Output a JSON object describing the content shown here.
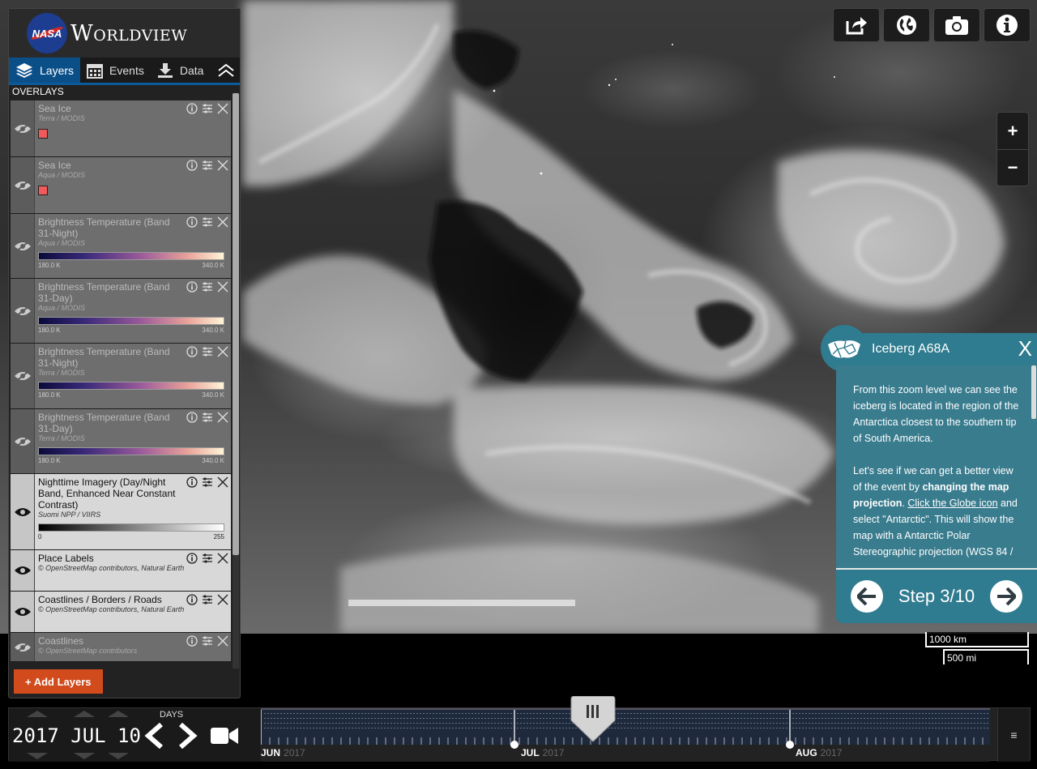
{
  "app": {
    "brand_text": "NASA",
    "title": "Worldview"
  },
  "tabs": [
    {
      "label": "Layers",
      "icon": "layers-icon"
    },
    {
      "label": "Events",
      "icon": "calendar-icon"
    },
    {
      "label": "Data",
      "icon": "download-icon"
    }
  ],
  "overlays_heading": "OVERLAYS",
  "layers": [
    {
      "name": "Sea Ice",
      "source": "Terra / MODIS",
      "visible": false,
      "legend": "swatch",
      "swatch_color": "#f05a5a"
    },
    {
      "name": "Sea Ice",
      "source": "Aqua / MODIS",
      "visible": false,
      "legend": "swatch",
      "swatch_color": "#f05a5a"
    },
    {
      "name": "Brightness Temperature (Band 31-Night)",
      "source": "Aqua / MODIS",
      "visible": false,
      "legend": "colorbar",
      "min": "180.0 K",
      "max": "340.0 K"
    },
    {
      "name": "Brightness Temperature (Band 31-Day)",
      "source": "Aqua / MODIS",
      "visible": false,
      "legend": "colorbar",
      "min": "180.0 K",
      "max": "340.0 K"
    },
    {
      "name": "Brightness Temperature (Band 31-Night)",
      "source": "Terra / MODIS",
      "visible": false,
      "legend": "colorbar",
      "min": "180.0 K",
      "max": "340.0 K"
    },
    {
      "name": "Brightness Temperature (Band 31-Day)",
      "source": "Terra / MODIS",
      "visible": false,
      "legend": "colorbar",
      "min": "180.0 K",
      "max": "340.0 K"
    },
    {
      "name": "Nighttime Imagery (Day/Night Band, Enhanced Near Constant Contrast)",
      "source": "Suomi NPP / VIIRS",
      "visible": true,
      "legend": "graybar",
      "min": "0",
      "max": "255"
    },
    {
      "name": "Place Labels",
      "source": "© OpenStreetMap contributors, Natural Earth",
      "visible": true,
      "legend": "none"
    },
    {
      "name": "Coastlines / Borders / Roads",
      "source": "© OpenStreetMap contributors, Natural Earth",
      "visible": true,
      "legend": "none"
    },
    {
      "name": "Coastlines",
      "source": "© OpenStreetMap contributors",
      "visible": false,
      "legend": "none"
    }
  ],
  "add_layers_label": "+ Add Layers",
  "toolbar": {
    "buttons": [
      "share-icon",
      "globe-icon",
      "camera-icon",
      "info-icon"
    ]
  },
  "zoom": {
    "in": "+",
    "out": "−"
  },
  "tour": {
    "title": "Iceberg A68A",
    "close": "X",
    "p1": "From this zoom level we can see the iceberg is located in the region of the Antarctica closest to the southern tip of South America.",
    "p2_a": "Let's see if we can get a better view of the event by ",
    "p2_bold": "changing the map projection",
    "p2_b": ". ",
    "p2_link": "Click the Globe icon",
    "p2_c": " and select \"Antarctic\". This will show the map with a Antarctic Polar Stereographic projection (WGS 84 /",
    "step": "Step 3/10"
  },
  "scale": {
    "km": "1000 km",
    "mi": "500 mi"
  },
  "timeline": {
    "date": "2017 JUL 10",
    "zoom_level": "DAYS",
    "months": [
      {
        "label": "JUN",
        "year": "2017"
      },
      {
        "label": "JUL",
        "year": "2017"
      },
      {
        "label": "AUG",
        "year": "2017"
      }
    ],
    "menu": "≡"
  }
}
